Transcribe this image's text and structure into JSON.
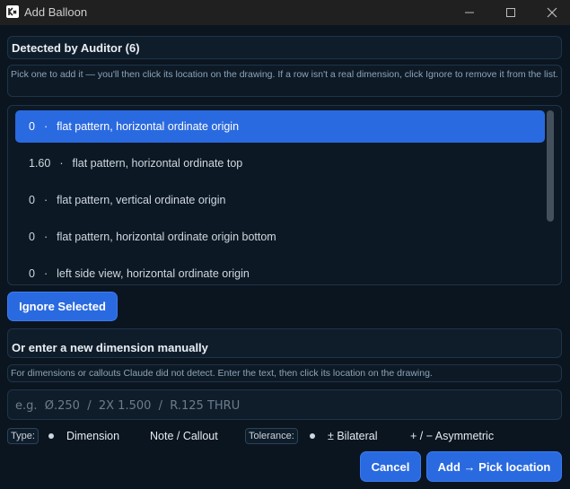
{
  "window": {
    "title": "Add Balloon",
    "app_icon": "logo-icon",
    "controls": [
      "minimize-icon",
      "maximize-icon",
      "close-icon"
    ]
  },
  "detected": {
    "header": "Detected by Auditor (6)",
    "hint": "Pick one to add it — you'll then click its location on the drawing. If a row isn't a real dimension, click Ignore to remove it from the list.",
    "items": [
      {
        "value": "0",
        "label": "flat pattern, horizontal ordinate origin",
        "selected": true
      },
      {
        "value": "1.60",
        "label": "flat pattern, horizontal ordinate top",
        "selected": false
      },
      {
        "value": "0",
        "label": "flat pattern, vertical ordinate origin",
        "selected": false
      },
      {
        "value": "0",
        "label": "flat pattern, horizontal ordinate origin bottom",
        "selected": false
      },
      {
        "value": "0",
        "label": "left side view, horizontal ordinate origin",
        "selected": false
      }
    ],
    "separator": "·",
    "ignore_label": "Ignore Selected"
  },
  "manual": {
    "header": "Or enter a new dimension manually",
    "hint": "For dimensions or callouts Claude did not detect. Enter the text, then click its location on the drawing.",
    "input_value": "",
    "input_placeholder": "e.g.  Ø.250  /  2X 1.500  /  R.125 THRU"
  },
  "options": {
    "type_label": "Type:",
    "type_options": [
      "Dimension",
      "Note / Callout"
    ],
    "type_selected": "Dimension",
    "tolerance_label": "Tolerance:",
    "tolerance_options": [
      "± Bilateral",
      "+ / − Asymmetric"
    ],
    "tolerance_selected": "± Bilateral"
  },
  "actions": {
    "cancel_label": "Cancel",
    "add_label": "Add → Pick location"
  },
  "colors": {
    "accent": "#2a6ae0",
    "background": "#0b1520"
  }
}
